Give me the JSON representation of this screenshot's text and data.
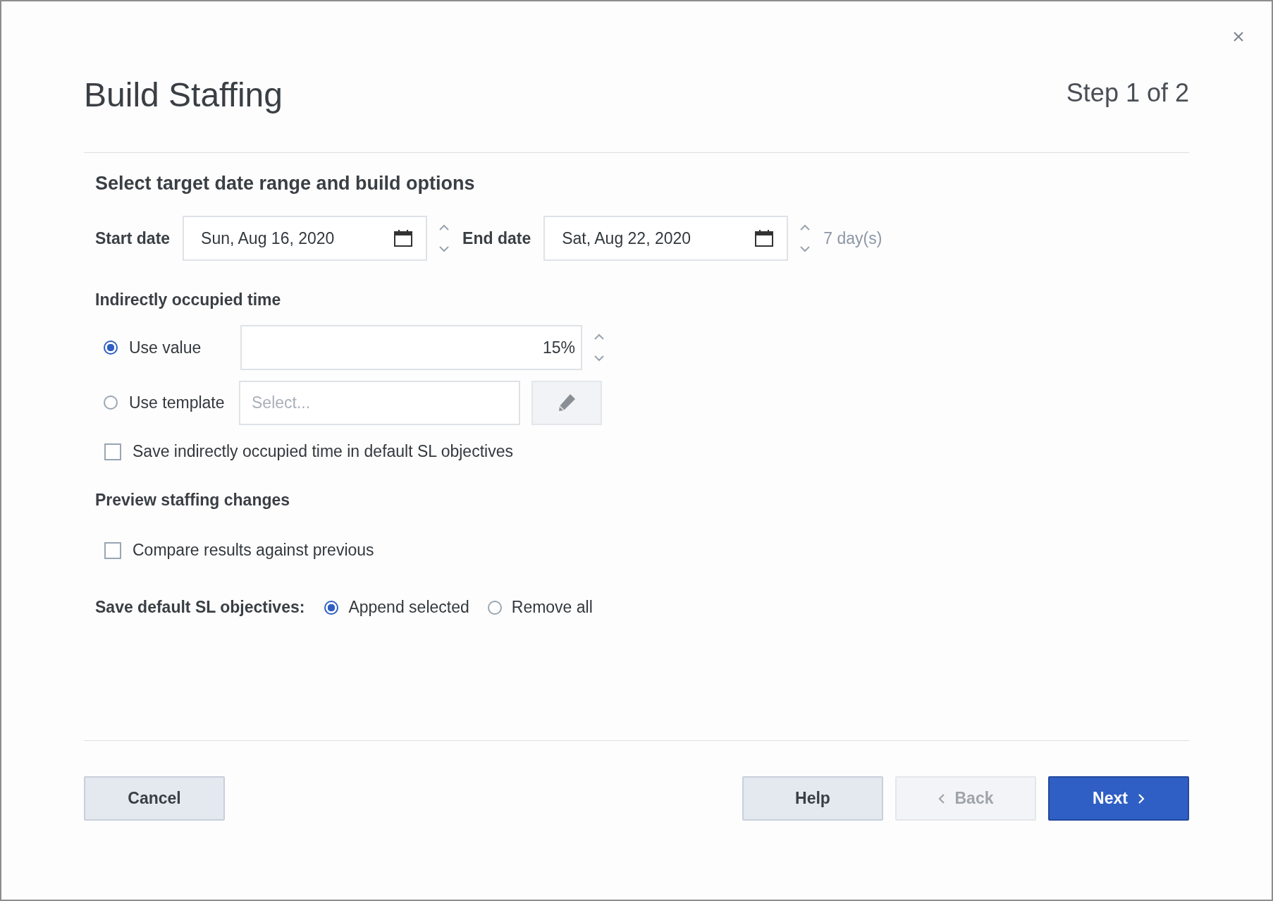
{
  "dialog": {
    "title": "Build Staffing",
    "step": "Step 1 of 2"
  },
  "section_title": "Select target date range and build options",
  "date_range": {
    "fields": [
      {
        "label": "Start date",
        "value": "Sun, Aug 16, 2020"
      },
      {
        "label": "End date",
        "value": "Sat, Aug 22, 2020"
      }
    ],
    "duration": "7 day(s)"
  },
  "indirect_time": {
    "heading": "Indirectly occupied time",
    "options": [
      {
        "kind": "value",
        "label": "Use value",
        "selected": true,
        "value": "15%"
      },
      {
        "kind": "template",
        "label": "Use template",
        "selected": false,
        "placeholder": "Select..."
      }
    ],
    "save_option": {
      "label": "Save indirectly occupied time in default SL objectives",
      "checked": false
    }
  },
  "preview": {
    "heading": "Preview staffing changes",
    "compare": {
      "label": "Compare results against previous",
      "checked": false
    }
  },
  "sl_objectives": {
    "label": "Save default SL objectives:",
    "options": [
      {
        "label": "Append selected",
        "selected": true
      },
      {
        "label": "Remove all",
        "selected": false
      }
    ]
  },
  "footer": {
    "left_buttons": [
      {
        "kind": "secondary",
        "label": "Cancel",
        "disabled": false
      }
    ],
    "right_buttons": [
      {
        "kind": "secondary",
        "label": "Help",
        "disabled": false
      },
      {
        "kind": "back",
        "label": "Back",
        "disabled": true
      },
      {
        "kind": "primary",
        "label": "Next",
        "disabled": false
      }
    ]
  }
}
